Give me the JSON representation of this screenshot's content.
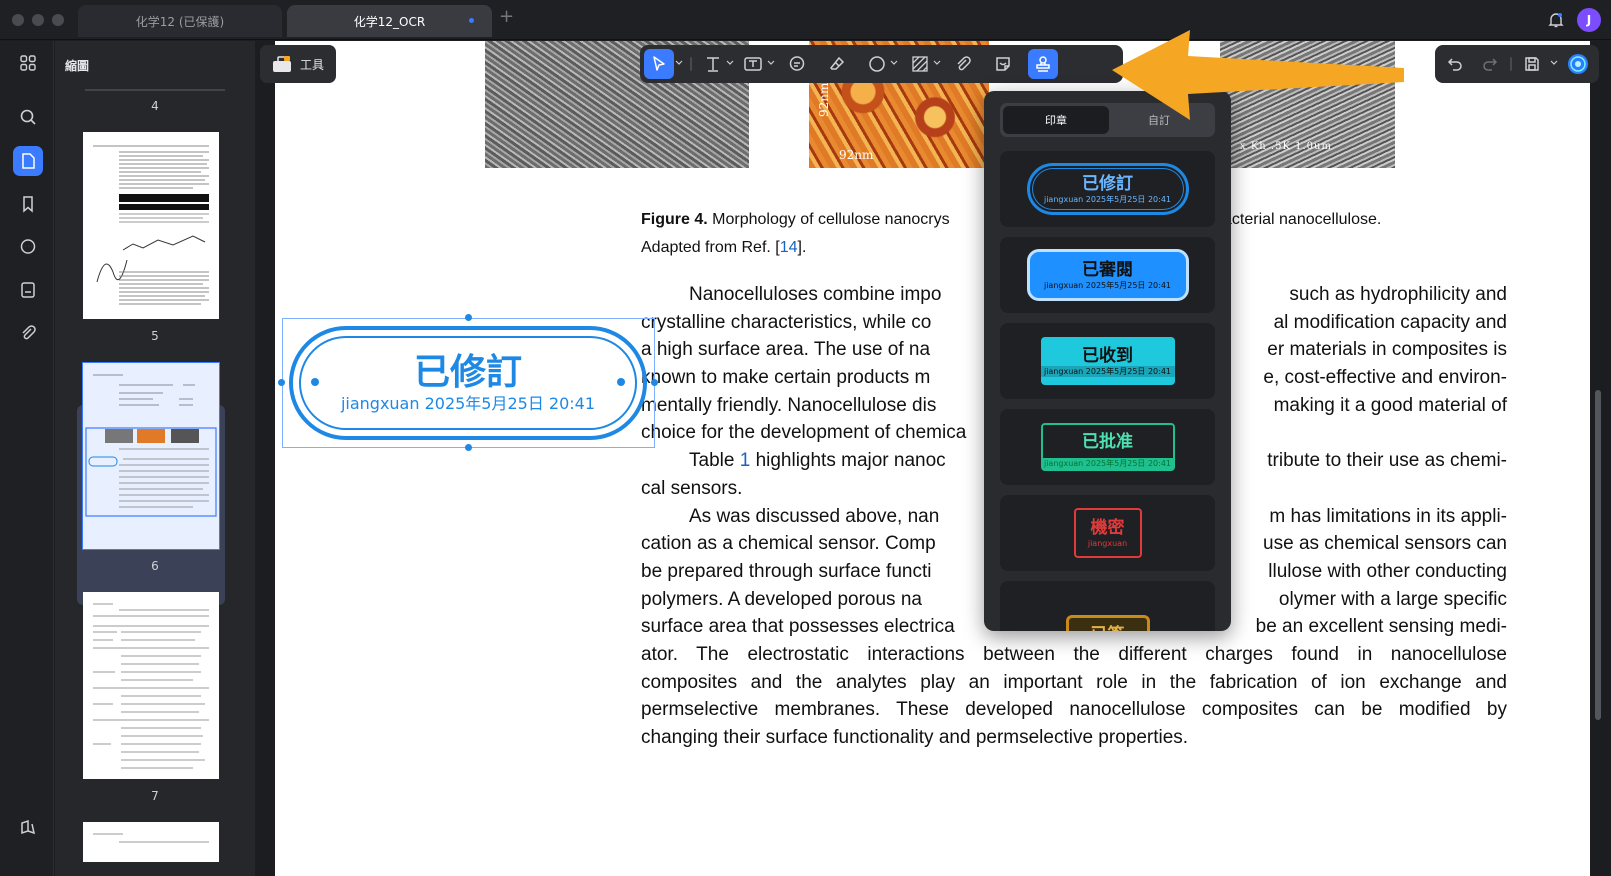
{
  "window": {
    "tabs": [
      {
        "label": "化学12 (已保護)",
        "active": false
      },
      {
        "label": "化学12_OCR",
        "active": true
      }
    ],
    "new_tab_symbol": "+",
    "avatar_letter": "J"
  },
  "sidebar": {
    "icons": [
      "grid-icon",
      "search-icon",
      "page-icon",
      "bookmark-icon",
      "comment-icon",
      "form-icon",
      "attachment-icon"
    ],
    "bottom_icon": "layers-icon",
    "selected_index": 2
  },
  "thumbnails": {
    "title": "縮圖",
    "pages": [
      "4",
      "5",
      "6",
      "7"
    ],
    "selected_page": "6"
  },
  "tools_button": {
    "label": "工具"
  },
  "toolbar": {
    "icons": [
      "select-arrow-icon",
      "text-icon",
      "textbox-icon",
      "comment-icon",
      "eraser-icon",
      "shape-circle-icon",
      "area-hatch-icon",
      "attachment-icon",
      "sticker-icon",
      "stamp-icon"
    ],
    "selected": "stamp-icon",
    "right_icons": [
      "undo-icon",
      "redo-icon",
      "save-icon",
      "ai-assistant-icon"
    ]
  },
  "document": {
    "figure_labels": {
      "scale_vertical": "92nm",
      "scale_horizontal": "92nm",
      "sem_info": "x Kh .5K 1.0um"
    },
    "caption_bold": "Figure 4.",
    "caption_lines": [
      "Morphology of cellulose nanocrys",
      "acterial nanocellulose.",
      "Adapted from Ref. [",
      "14",
      "]."
    ],
    "para1": [
      "Nanocelluloses combine impo",
      "such as hydrophilicity and",
      "crystalline characteristics, while co",
      "al modification capacity and",
      "a high surface area. The use of na",
      "er materials in composites is",
      "known to make certain products m",
      "e, cost-effective and environ-",
      "mentally friendly. Nanocellulose dis",
      "making it a good material of",
      "choice for the development of chemica"
    ],
    "para2": [
      "Table",
      "1",
      "highlights major nanoc",
      "tribute to their use as chemi-",
      "cal sensors."
    ],
    "para3": [
      "As was discussed above, nan",
      "m has limitations in its appli-",
      "cation as a chemical sensor. Comp",
      "use as chemical sensors can",
      "be prepared through surface functi",
      "llulose with other conducting",
      "polymers. A developed porous na",
      "olymer with a large specific",
      "surface area that possesses electrica",
      "be an excellent sensing medi-",
      "ator. The electrostatic interactions between the different charges found in nanocellulose",
      "composites and the analytes play an important role in the fabrication of ion exchange and",
      "permselective membranes. These developed nanocellulose composites can be modified by",
      "changing their surface functionality and permselective properties."
    ]
  },
  "placed_stamp": {
    "title": "已修訂",
    "subtitle": "jiangxuan 2025年5月25日 20:41",
    "color": "#1e88e5"
  },
  "stamp_popup": {
    "tabs": [
      "印章",
      "自訂"
    ],
    "selected_tab": "印章",
    "stamps": [
      {
        "title": "已修訂",
        "subtitle": "jiangxuan 2025年5月25日 20:41",
        "color": "#1e88e5"
      },
      {
        "title": "已審閱",
        "subtitle": "jiangxuan 2025年5月25日 20:41",
        "color": "#1e90ff"
      },
      {
        "title": "已收到",
        "subtitle": "jiangxuan 2025年5月25日 20:41",
        "color": "#1ec8dd"
      },
      {
        "title": "已批准",
        "subtitle": "jiangxuan 2025年5月25日 20:41",
        "color": "#1fbf8f"
      },
      {
        "title": "機密",
        "subtitle": "jiangxuan",
        "color": "#e03a3a"
      },
      {
        "title": "已簽",
        "subtitle": "",
        "color": "#c98a1a"
      }
    ]
  },
  "annotation_arrow_color": "#f5a623"
}
